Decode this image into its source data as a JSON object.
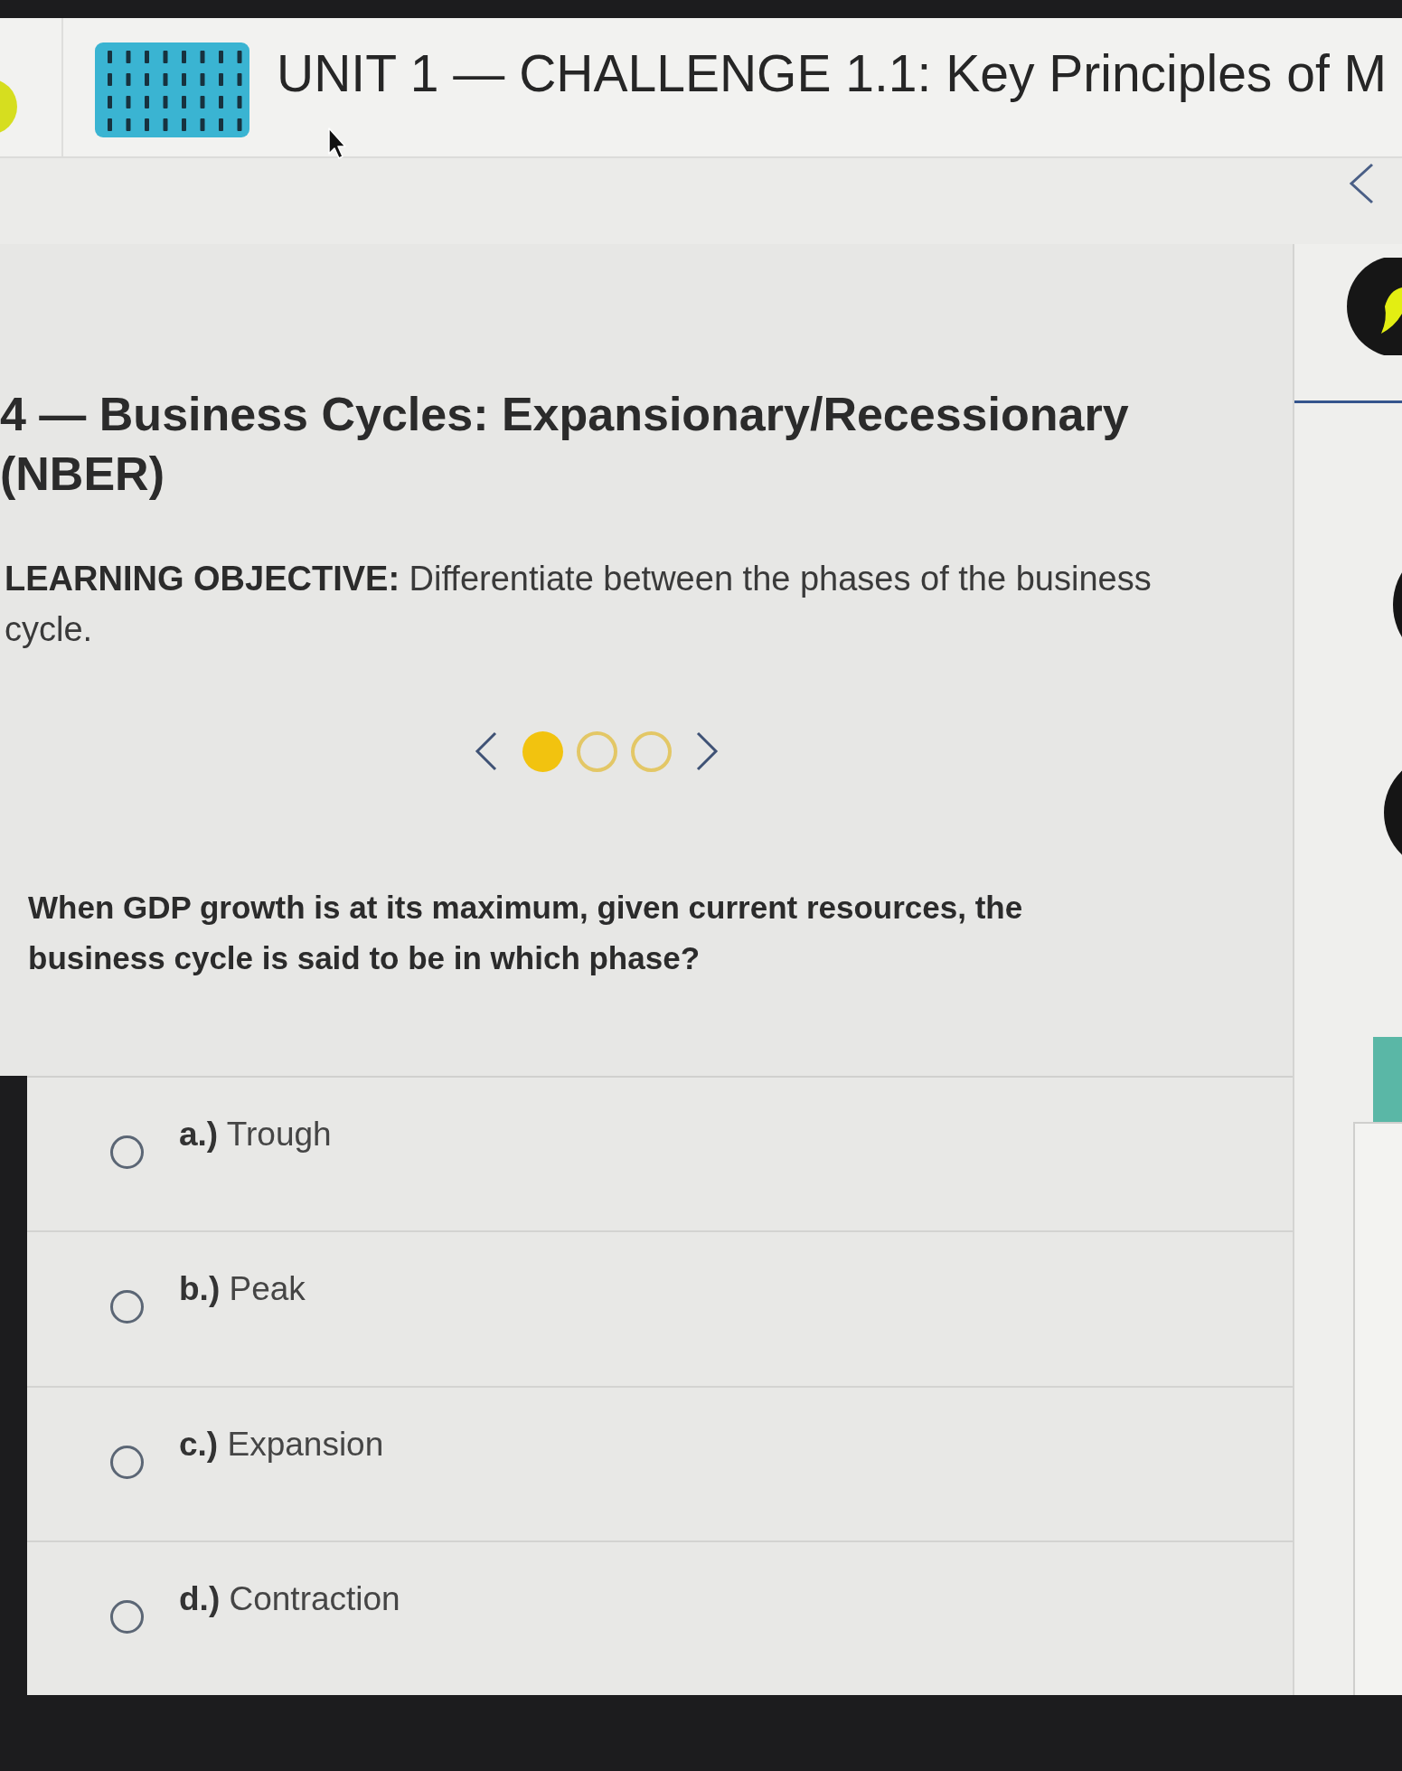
{
  "header": {
    "title": "UNIT 1 — CHALLENGE 1.1: Key Principles of M"
  },
  "lesson": {
    "title": "4 — Business Cycles: Expansionary/Recessionary (NBER)",
    "objective": "**LEARNING OBJECTIVE:** Differentiate between the phases of the business cycle."
  },
  "pager": {
    "pages": [
      {
        "selected": true
      },
      {
        "selected": false
      },
      {
        "selected": false
      }
    ]
  },
  "question": {
    "text": "When GDP growth is at its maximum, given current resources, the business cycle is said to be in which phase?",
    "options": [
      {
        "label": "**a.)** Trough",
        "selected": false
      },
      {
        "label": "**b.)** Peak",
        "selected": false
      },
      {
        "label": "**c.)** Expansion",
        "selected": false
      },
      {
        "label": "**d.)** Contraction",
        "selected": false
      }
    ]
  }
}
